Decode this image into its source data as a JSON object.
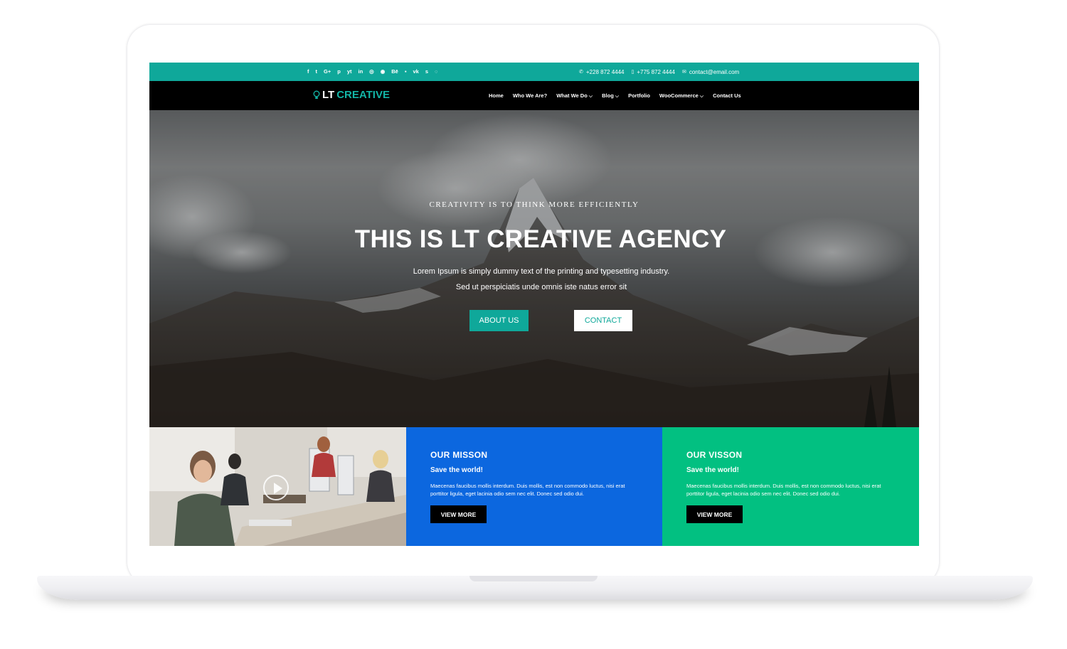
{
  "topbar": {
    "social": [
      "f",
      "t",
      "G+",
      "p",
      "yt",
      "in",
      "◎",
      "◉",
      "Bē",
      "▪",
      "vk",
      "s",
      "◌"
    ],
    "phone1": "+228 872 4444",
    "phone2": "+775 872 4444",
    "email": "contact@email.com"
  },
  "logo": {
    "part1": "LT",
    "part2": "CREATIVE"
  },
  "nav": {
    "items": [
      {
        "label": "Home",
        "active": true,
        "dropdown": false
      },
      {
        "label": "Who We Are?",
        "active": false,
        "dropdown": false
      },
      {
        "label": "What We Do",
        "active": false,
        "dropdown": true
      },
      {
        "label": "Blog",
        "active": false,
        "dropdown": true
      },
      {
        "label": "Portfolio",
        "active": false,
        "dropdown": false
      },
      {
        "label": "WooCommerce",
        "active": false,
        "dropdown": true
      },
      {
        "label": "Contact Us",
        "active": false,
        "dropdown": false
      }
    ]
  },
  "hero": {
    "subtitle": "CREATIVITY IS TO THINK MORE EFFICIENTLY",
    "title": "THIS IS LT CREATIVE AGENCY",
    "line1": "Lorem Ipsum is simply dummy text of the printing and typesetting industry.",
    "line2": "Sed ut perspiciatis unde omnis iste natus error sit",
    "btn_about": "ABOUT US",
    "btn_contact": "CONTACT"
  },
  "mission": {
    "title": "OUR MISSON",
    "subtitle": "Save the world!",
    "text": "Maecenas faucibus mollis interdum. Duis mollis, est non commodo luctus, nisi erat porttitor ligula, eget lacinia odio sem nec elit. Donec sed odio dui.",
    "button": "VIEW MORE"
  },
  "vision": {
    "title": "OUR VISSON",
    "subtitle": "Save the world!",
    "text": "Maecenas faucibus mollis interdum. Duis mollis, est non commodo luctus, nisi erat porttitor ligula, eget lacinia odio sem nec elit. Donec sed odio dui.",
    "button": "VIEW MORE"
  },
  "colors": {
    "teal": "#0fa89a",
    "blue": "#0c67df",
    "green": "#02c081",
    "black": "#000000"
  }
}
